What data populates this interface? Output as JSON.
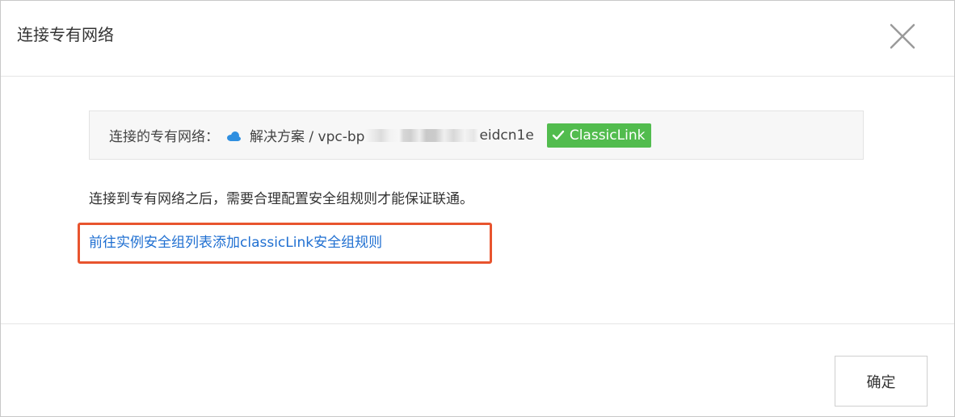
{
  "dialog": {
    "title": "连接专有网络",
    "close_icon": "close-icon"
  },
  "vpc_info": {
    "label": "连接的专有网络：",
    "cloud_icon": "cloud-icon",
    "vpc_name": "解决方案 / vpc-bp",
    "vpc_id_suffix": "eidcn1e",
    "badge_icon": "check-icon",
    "badge_label": "ClassicLink",
    "badge_color": "#52bc4e"
  },
  "notice": "连接到专有网络之后，需要合理配置安全组规则才能保证联通。",
  "link": {
    "text": "前往实例安全组列表添加classicLink安全组规则",
    "color": "#1f6fd1",
    "highlight_color": "#e8542e"
  },
  "footer": {
    "ok_label": "确定"
  }
}
